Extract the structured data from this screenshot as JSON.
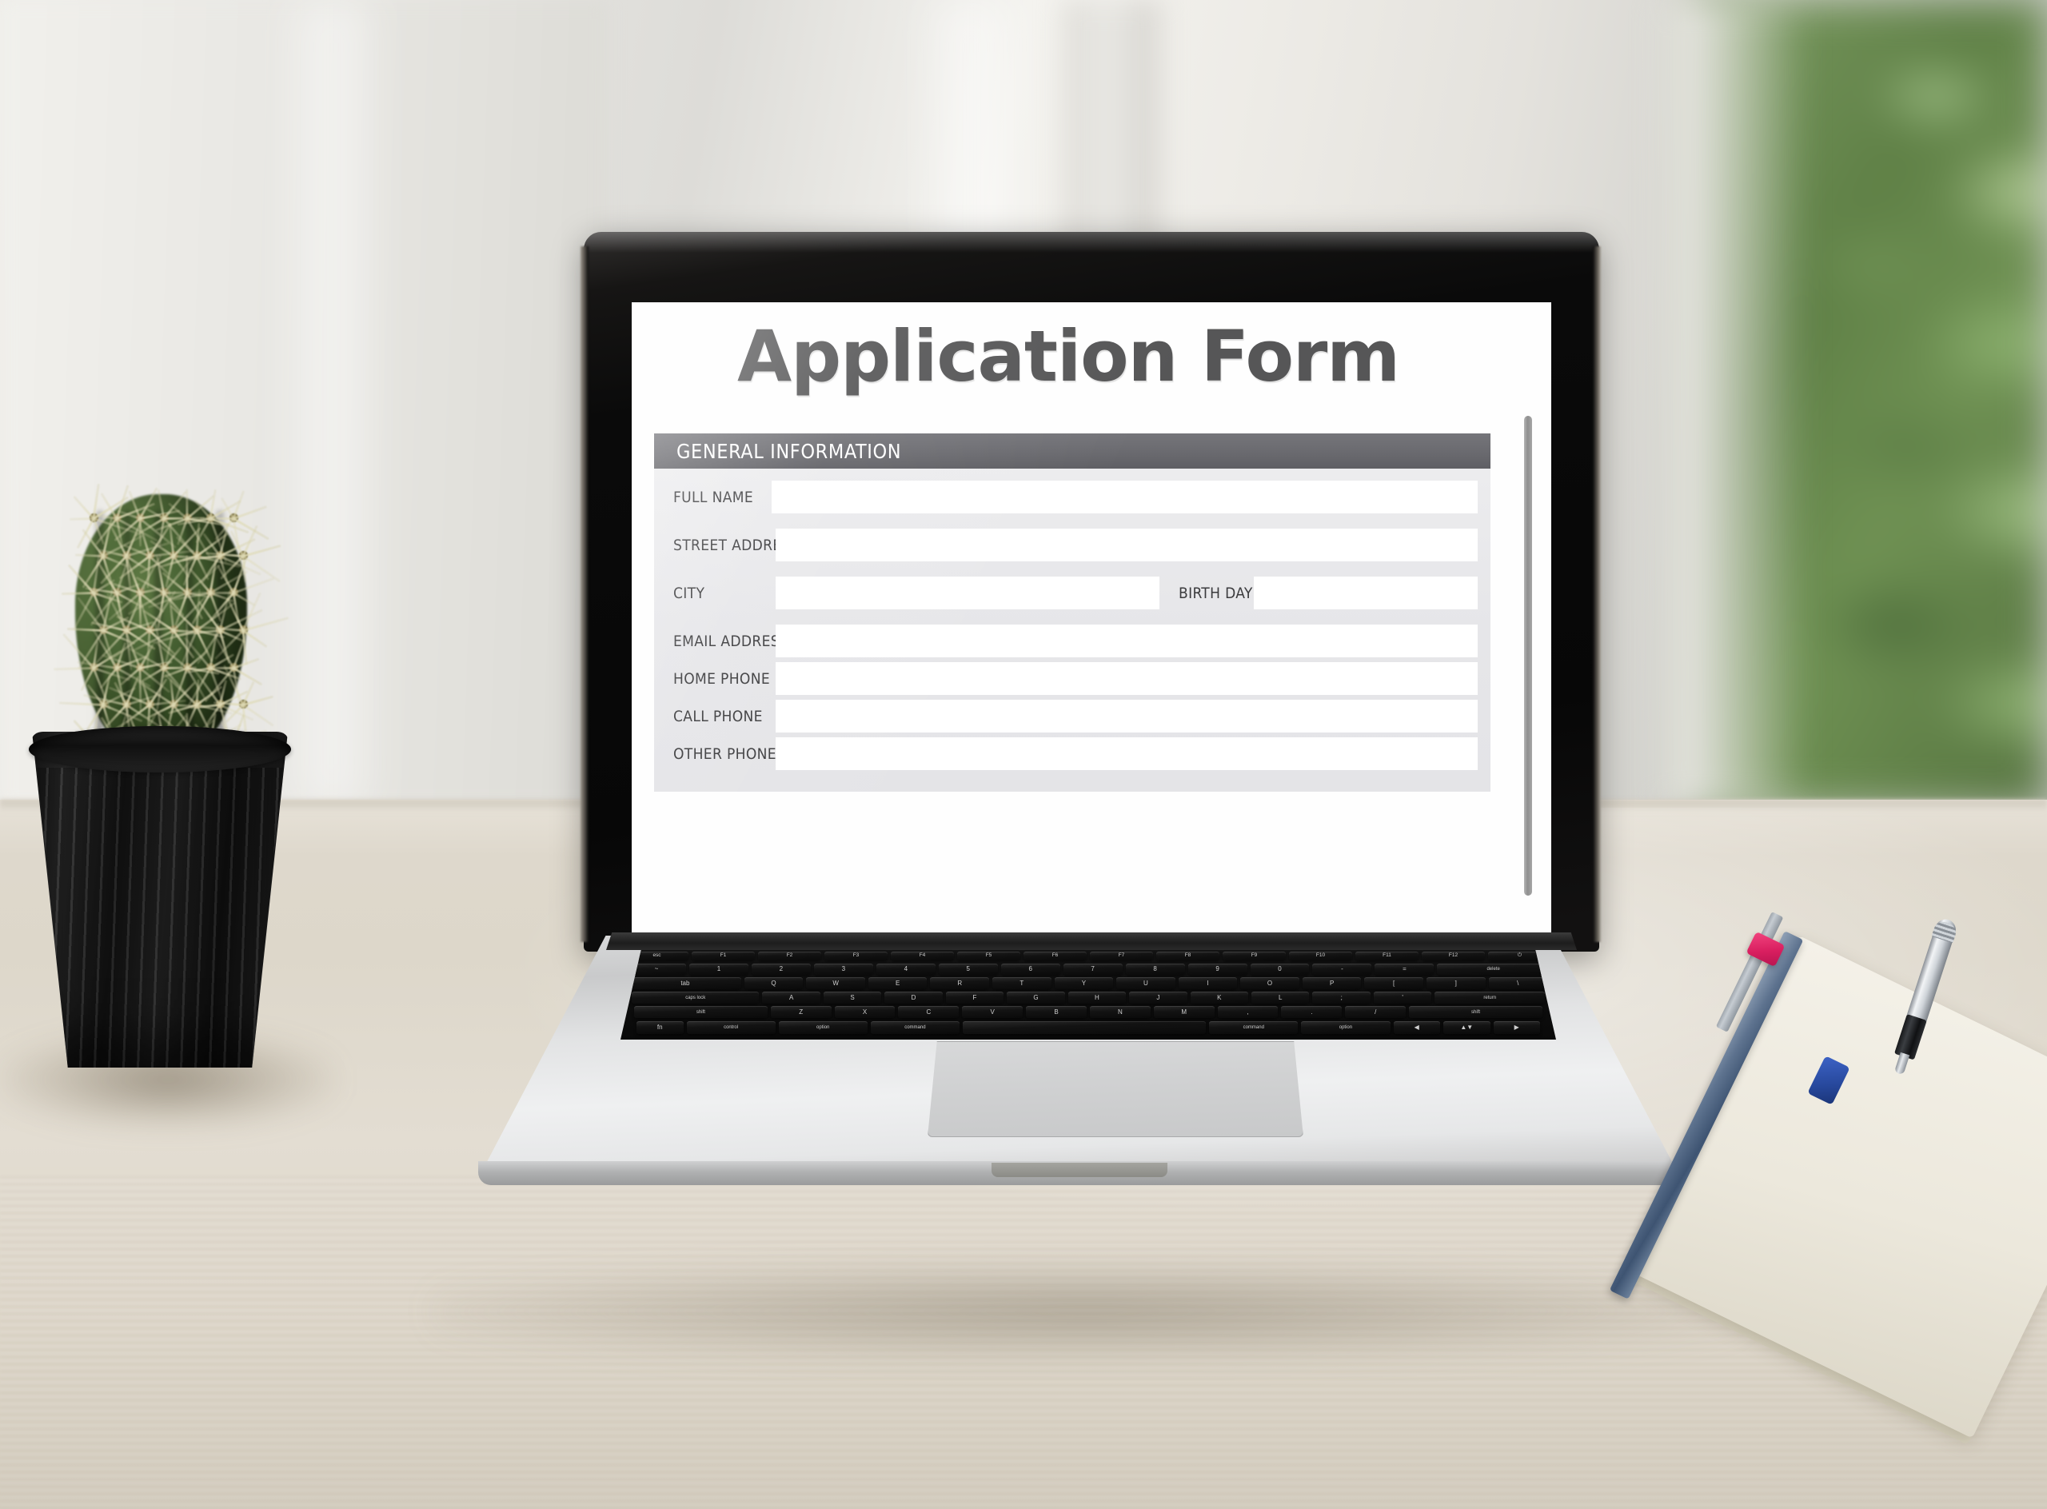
{
  "scene": {
    "description": "laptop-on-desk-photo",
    "desk_color": "#ded8cc",
    "foliage_color": "#6f9153",
    "cactus_color": "#4b6636",
    "pot_color": "#141414"
  },
  "screen": {
    "page_title": "Application Form",
    "title_color": "#565657",
    "section": {
      "header_label": "GENERAL INFORMATION",
      "header_bg": "#6a6a6f",
      "header_text_color": "#ffffff",
      "panel_bg": "#e6e6e9"
    },
    "fields": [
      {
        "label": "FULL NAME",
        "value": "",
        "placeholder": ""
      },
      {
        "label": "STREET ADDRESS",
        "value": "",
        "placeholder": ""
      },
      {
        "label": "CITY",
        "value": "",
        "placeholder": ""
      },
      {
        "label": "BIRTH DAY",
        "value": "",
        "placeholder": ""
      },
      {
        "label": "EMAIL ADDRESS",
        "value": "",
        "placeholder": ""
      },
      {
        "label": "HOME PHONE",
        "value": "",
        "placeholder": ""
      },
      {
        "label": "CALL PHONE",
        "value": "",
        "placeholder": ""
      },
      {
        "label": "OTHER PHONE",
        "value": "",
        "placeholder": ""
      }
    ],
    "scrollbar": {
      "orientation": "vertical",
      "thumb_color": "#9a9a9a"
    }
  },
  "hardware": {
    "device": "laptop",
    "keyboard": {
      "row1": [
        "esc",
        "F1",
        "F2",
        "F3",
        "F4",
        "F5",
        "F6",
        "F7",
        "F8",
        "F9",
        "F10",
        "F11",
        "F12",
        "⏻"
      ],
      "row2": [
        "~",
        "1",
        "2",
        "3",
        "4",
        "5",
        "6",
        "7",
        "8",
        "9",
        "0",
        "-",
        "=",
        "delete"
      ],
      "row3": [
        "tab",
        "Q",
        "W",
        "E",
        "R",
        "T",
        "Y",
        "U",
        "I",
        "O",
        "P",
        "[",
        "]",
        "\\"
      ],
      "row4": [
        "caps lock",
        "A",
        "S",
        "D",
        "F",
        "G",
        "H",
        "J",
        "K",
        "L",
        ";",
        "'",
        "return"
      ],
      "row5": [
        "shift",
        "Z",
        "X",
        "C",
        "V",
        "B",
        "N",
        "M",
        ",",
        ".",
        "/",
        "shift"
      ],
      "row6": [
        "fn",
        "control",
        "option",
        "command",
        "",
        "command",
        "option",
        "◀",
        "▲▼",
        "▶"
      ]
    },
    "trackpad_label": "trackpad"
  },
  "desk_items": [
    {
      "name": "cactus-plant",
      "label": "cactus in black pot"
    },
    {
      "name": "notebook",
      "label": "notebook"
    },
    {
      "name": "pencil",
      "label": "pencil with pink eraser"
    },
    {
      "name": "pen",
      "label": "silver ballpoint pen"
    }
  ]
}
